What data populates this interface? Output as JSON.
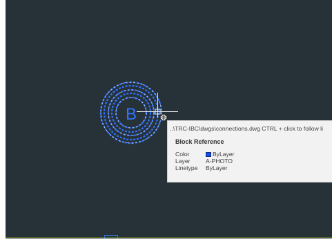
{
  "colors": {
    "canvas_background": "#273238",
    "block_linework": "#2f73ff",
    "crosshair": "#e8e8e8",
    "tooltip_background": "#f2f2f2",
    "bylayer_swatch": "#0a4dff"
  },
  "block": {
    "letter": "B",
    "icon": "dashed-concentric-circles-selected"
  },
  "tooltip": {
    "path": "..\\TRC-IBC\\dwgs\\connections.dwg CTRL + click to follow li",
    "title": "Block Reference",
    "properties": [
      {
        "label": "Color",
        "value": "ByLayer",
        "has_swatch": true
      },
      {
        "label": "Layer",
        "value": "A-PHOTO",
        "has_swatch": false
      },
      {
        "label": "Linetype",
        "value": "ByLayer",
        "has_swatch": false
      }
    ]
  },
  "cursor": {
    "icon": "hyperlink-globe-icon"
  }
}
